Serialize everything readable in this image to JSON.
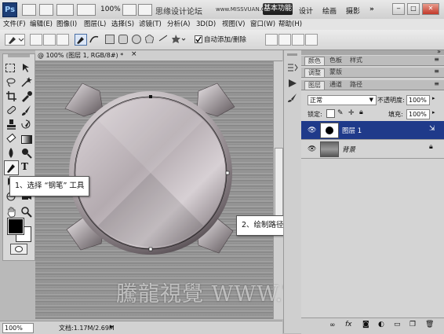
{
  "appbar": {
    "logo": "Ps",
    "zoom": "100%",
    "site_watermark": "思缘设计论坛",
    "site_url": "www.MISSVUAN.COM",
    "workspace_active": "基本功能",
    "workspace_links": [
      "设计",
      "绘画",
      "摄影"
    ],
    "more": "»",
    "window_controls": [
      "minimize-icon",
      "maximize-icon",
      "close-icon"
    ]
  },
  "menubar": {
    "items": [
      "文件(F)",
      "编辑(E)",
      "图像(I)",
      "图层(L)",
      "选择(S)",
      "滤镜(T)",
      "分析(A)",
      "3D(D)",
      "视图(V)",
      "窗口(W)",
      "帮助(H)"
    ]
  },
  "options": {
    "auto_add_delete_label": "自动添加/删除",
    "auto_add_delete_checked": true
  },
  "document": {
    "tab_title": "@ 100% (图层 1, RGB/8#) *",
    "close_icon": "×",
    "zoom": "100%",
    "info": "文档:1.17M/2.69M"
  },
  "callouts": {
    "step1": "1、选择 “钢笔” 工具",
    "step2": "2、绘制路径"
  },
  "watermark_bottom": "騰龍視覺 WWW.TLVI.NET",
  "panels": {
    "group1_tabs": [
      "颜色",
      "色板",
      "样式"
    ],
    "group2_tabs": [
      "调整",
      "蒙版"
    ],
    "group3_tabs": [
      "图层",
      "通道",
      "路径"
    ],
    "blend_mode": "正常",
    "opacity_label": "不透明度:",
    "opacity_value": "100%",
    "lock_label": "锁定:",
    "fill_label": "填充:",
    "fill_value": "100%",
    "layers": [
      {
        "name": "图层 1",
        "selected": true
      },
      {
        "name": "背景",
        "selected": false
      }
    ]
  },
  "colors": {
    "selected_layer": "#1f3a8a",
    "foreground": "#000000",
    "background": "#ffffff"
  }
}
